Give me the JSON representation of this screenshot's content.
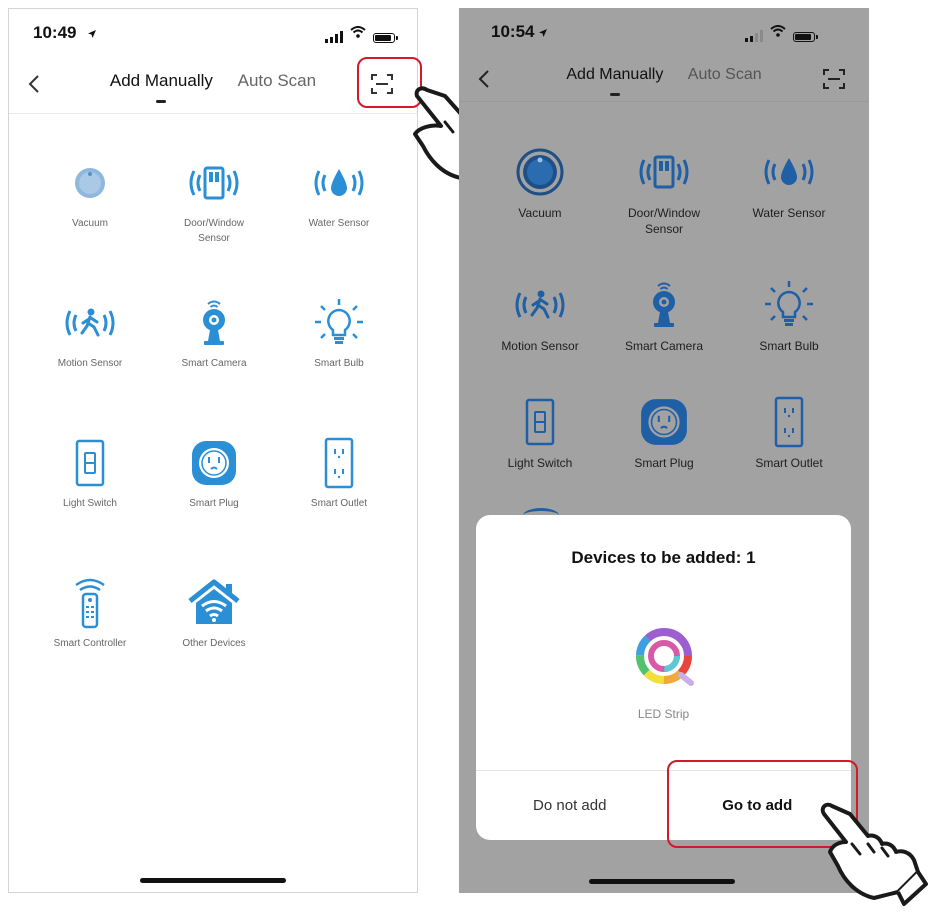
{
  "left": {
    "status_time": "10:49",
    "tabs": {
      "manual": "Add Manually",
      "scan": "Auto Scan"
    },
    "devices": [
      {
        "label": "Vacuum"
      },
      {
        "label": "Door/Window\nSensor"
      },
      {
        "label": "Water Sensor"
      },
      {
        "label": "Motion Sensor"
      },
      {
        "label": "Smart Camera"
      },
      {
        "label": "Smart Bulb"
      },
      {
        "label": "Light Switch"
      },
      {
        "label": "Smart Plug"
      },
      {
        "label": "Smart Outlet"
      },
      {
        "label": "Smart Controller"
      },
      {
        "label": "Other Devices"
      }
    ]
  },
  "right": {
    "status_time": "10:54",
    "tabs": {
      "manual": "Add Manually",
      "scan": "Auto Scan"
    },
    "devices": [
      {
        "label": "Vacuum"
      },
      {
        "label": "Door/Window\nSensor"
      },
      {
        "label": "Water Sensor"
      },
      {
        "label": "Motion Sensor"
      },
      {
        "label": "Smart Camera"
      },
      {
        "label": "Smart Bulb"
      },
      {
        "label": "Light Switch"
      },
      {
        "label": "Smart Plug"
      },
      {
        "label": "Smart Outlet"
      }
    ],
    "modal": {
      "title": "Devices to be added: 1",
      "device_label": "LED Strip",
      "cancel_label": "Do not add",
      "confirm_label": "Go to add"
    }
  },
  "colors": {
    "accent_blue": "#2b8fd6",
    "highlight_red": "#d11a2a",
    "overlay_gray": "#a2a2a2"
  },
  "icons": {
    "back": "chevron-left-icon",
    "scan": "scan-frame-icon",
    "pointer": "pointing-hand-icon"
  }
}
